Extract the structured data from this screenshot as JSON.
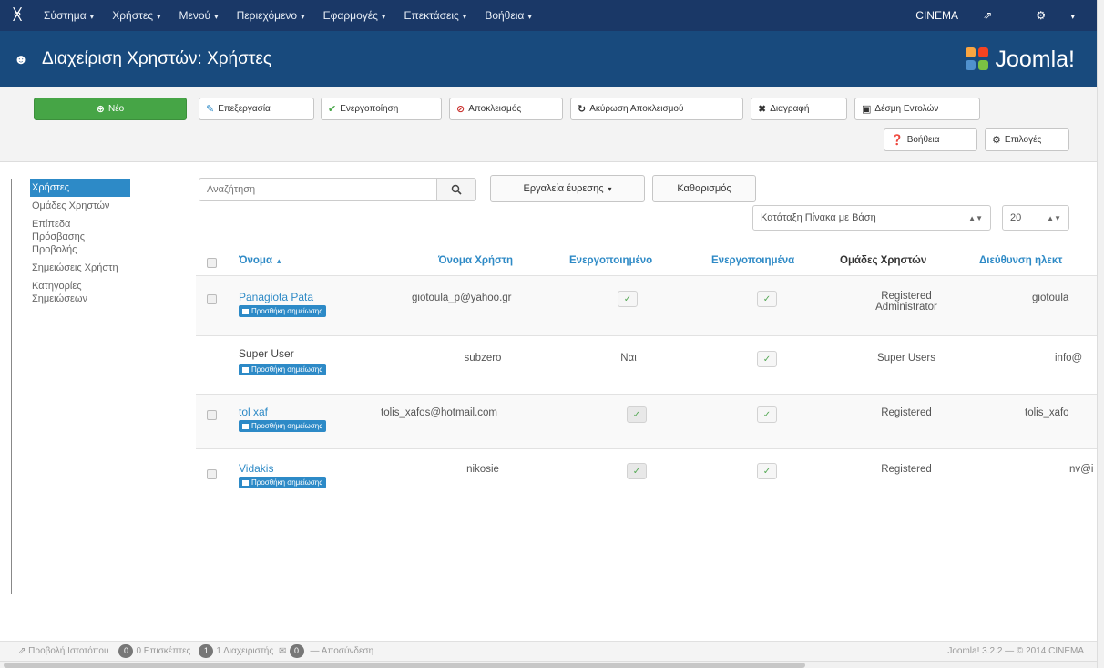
{
  "topnav": {
    "logo": "ᚸ",
    "menu": [
      {
        "label": "Σύστημα"
      },
      {
        "label": "Χρήστες"
      },
      {
        "label": "Μενού"
      },
      {
        "label": "Περιεχόμενο"
      },
      {
        "label": "Εφαρμογές"
      },
      {
        "label": "Επεκτάσεις"
      },
      {
        "label": "Βοήθεια"
      }
    ],
    "site_label": "CINEMA",
    "site_icon": "⇗",
    "gear_icon": "⚙"
  },
  "titlebar": {
    "title": "Διαχείριση Χρηστών: Χρήστες",
    "brand": "Joomla!"
  },
  "toolbar": {
    "new_label": "Νέο",
    "edit_label": "Επεξεργασία",
    "activate_label": "Ενεργοποίηση",
    "block_label": "Αποκλεισμός",
    "unblock_label": "Ακύρωση Αποκλεισμού",
    "delete_label": "Διαγραφή",
    "batch_label": "Δέσμη Εντολών",
    "help_label": "Βοήθεια",
    "options_label": "Επιλογές"
  },
  "sidebar": {
    "items": [
      {
        "label": "Χρήστες",
        "active": true
      },
      {
        "label": "Ομάδες Χρηστών"
      },
      {
        "label": "Επίπεδα Πρόσβασης Προβολής"
      },
      {
        "label": "Σημειώσεις Χρήστη"
      },
      {
        "label": "Κατηγορίες Σημειώσεων"
      }
    ]
  },
  "filters": {
    "search_placeholder": "Αναζήτηση",
    "search_tools_label": "Εργαλεία έυρεσης",
    "clear_label": "Καθαρισμός",
    "sort_label": "Κατάταξη Πίνακα με Βάση",
    "limit_value": "20"
  },
  "table": {
    "headers": {
      "name": "Όνομα",
      "username": "Όνομα Χρήστη",
      "enabled": "Ενεργοποιημένο",
      "activated": "Ενεργοποιημένα",
      "groups": "Ομάδες Χρηστών",
      "email": "Διεύθυνση ηλεκτ"
    },
    "add_note_label": "Προσθήκη σημείωσης",
    "rows": [
      {
        "name": "Panagiota Pata",
        "username": "giotoula_p@yahoo.gr",
        "enabled": "✓",
        "activated": "✓",
        "group_line1": "Registered",
        "group_line2": "Administrator",
        "email": "giotoula"
      },
      {
        "name": "Super User",
        "username": "subzero",
        "enabled": "Ναι",
        "activated": "✓",
        "group_line1": "Super Users",
        "group_line2": "",
        "email": "info@"
      },
      {
        "name": "tol xaf",
        "username": "tolis_xafos@hotmail.com",
        "enabled": "✓",
        "activated": "✓",
        "group_line1": "Registered",
        "group_line2": "",
        "email": "tolis_xafo"
      },
      {
        "name": "Vidakis",
        "username": "nikosie",
        "enabled": "✓",
        "activated": "✓",
        "group_line1": "Registered",
        "group_line2": "",
        "email": "nv@i"
      }
    ]
  },
  "footer": {
    "view_site": "Προβολή Ιστοτόπου",
    "visitors_count": "0",
    "visitors_label": "0 Επισκέπτες",
    "admins_count": "1",
    "admins_label": "1 Διαχειριστής",
    "messages_count": "0",
    "logout_label": "Αποσύνδεση",
    "version": "Joomla! 3.2.2 — © 2014 CINEMA"
  }
}
